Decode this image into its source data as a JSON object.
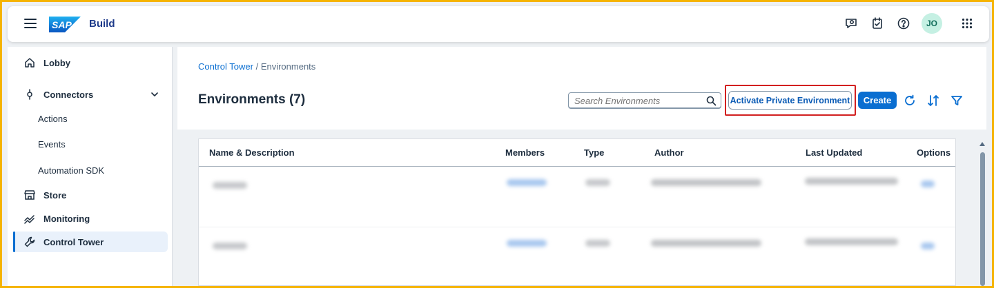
{
  "shell": {
    "logo_text": "SAP",
    "product_name": "Build",
    "avatar_initials": "JO",
    "icons": [
      "menu-icon",
      "feedback-icon",
      "notifications-icon",
      "help-icon",
      "avatar",
      "apps-grid-icon"
    ]
  },
  "sidebar": {
    "items": [
      {
        "label": "Lobby",
        "icon": "home-icon"
      },
      {
        "label": "Connectors",
        "icon": "connector-icon",
        "expanded": true
      },
      {
        "label": "Actions"
      },
      {
        "label": "Events"
      },
      {
        "label": "Automation SDK"
      },
      {
        "label": "Store",
        "icon": "store-icon"
      },
      {
        "label": "Monitoring",
        "icon": "monitoring-icon"
      },
      {
        "label": "Control Tower",
        "icon": "wrench-icon",
        "active": true
      }
    ]
  },
  "breadcrumb": {
    "parent": "Control Tower",
    "separator": " / ",
    "current": "Environments"
  },
  "page": {
    "title": "Environments (7)",
    "search_placeholder": "Search Environments",
    "activate_button": "Activate Private Environment",
    "create_button": "Create"
  },
  "table": {
    "columns": [
      "Name & Description",
      "Members",
      "Type",
      "Author",
      "Last Updated",
      "Options"
    ],
    "rows_blurred": true,
    "row_count_visible": 2
  },
  "colors": {
    "accent": "#0a6ed1",
    "highlight": "#d21f1f",
    "frame": "#f5b400"
  }
}
